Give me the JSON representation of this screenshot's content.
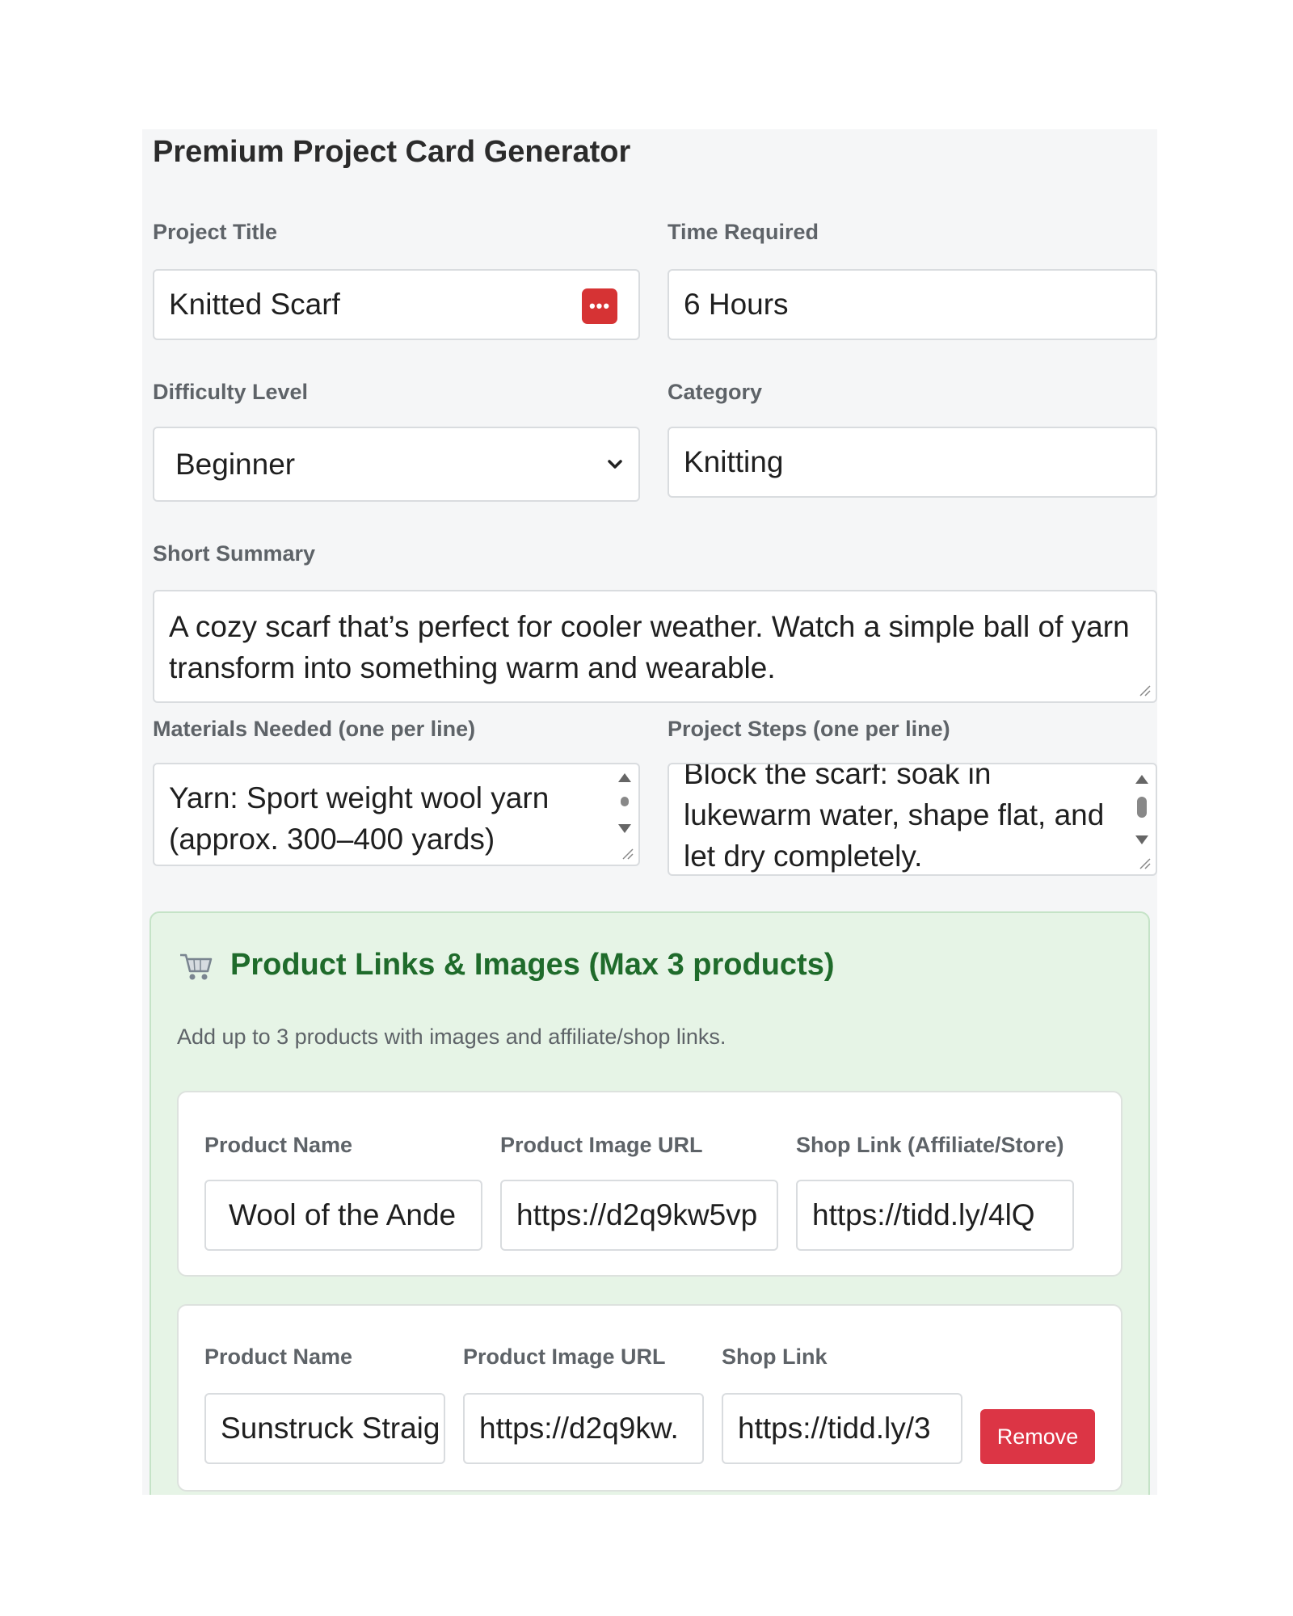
{
  "form": {
    "title": "Premium Project Card Generator",
    "project_title": {
      "label": "Project Title",
      "value": "Knitted Scarf"
    },
    "time_required": {
      "label": "Time Required",
      "value": "6 Hours"
    },
    "difficulty": {
      "label": "Difficulty Level",
      "value": "Beginner"
    },
    "category": {
      "label": "Category",
      "value": "Knitting"
    },
    "summary": {
      "label": "Short Summary",
      "value": "A cozy scarf that’s perfect for cooler weather. Watch a simple ball of yarn transform into something warm and wearable."
    },
    "materials": {
      "label": "Materials Needed (one per line)",
      "value": "Yarn: Sport weight wool yarn (approx. 300–400 yards)"
    },
    "steps": {
      "label": "Project Steps (one per line)",
      "value": "Block the scarf: soak in lukewarm water, shape flat, and let dry completely."
    }
  },
  "products": {
    "icon": "shopping-cart-icon",
    "title": "Product Links & Images (Max 3 products)",
    "subtitle": "Add up to 3 products with images and affiliate/shop links.",
    "items": [
      {
        "name_label": "Product Name",
        "image_label": "Product Image URL",
        "link_label": "Shop Link (Affiliate/Store)",
        "name": "Wool of the Ande",
        "image_url": "https://d2q9kw5vp",
        "link": "https://tidd.ly/4lQ"
      },
      {
        "name_label": "Product Name",
        "image_label": "Product Image URL",
        "link_label": "Shop Link",
        "name": "Sunstruck Straig",
        "image_url": "https://d2q9kw.",
        "link": "https://tidd.ly/3",
        "remove_label": "Remove"
      }
    ]
  },
  "colors": {
    "panel_bg": "#f5f6f7",
    "products_bg": "#e6f4e6",
    "products_title": "#1f6b2b",
    "danger": "#dc3545"
  }
}
